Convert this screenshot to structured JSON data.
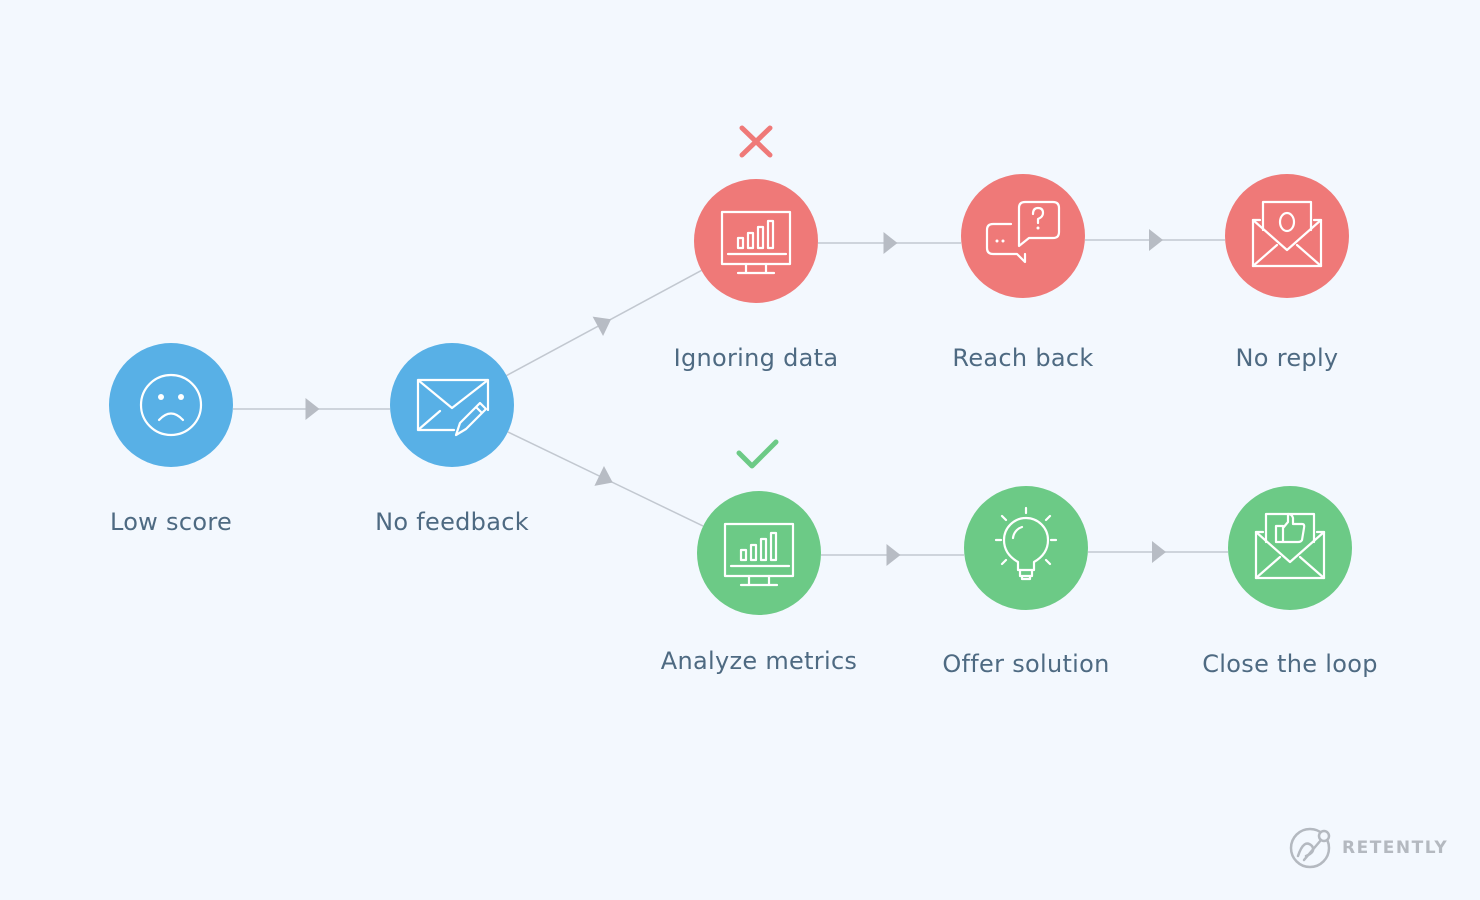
{
  "colors": {
    "background": "#f3f8fe",
    "blue": "#58b0e6",
    "red": "#ef7978",
    "green": "#6cca86",
    "connector": "#c2c8d0",
    "arrow": "#b7bcc4",
    "label": "#4e6a82",
    "fail_mark": "#ef7978",
    "success_mark": "#6cca86",
    "logo": "#b4b9c0"
  },
  "nodes": [
    {
      "id": "low-score",
      "label": "Low score",
      "icon": "sad-face-icon",
      "color": "blue"
    },
    {
      "id": "no-feedback",
      "label": "No feedback",
      "icon": "envelope-pencil-icon",
      "color": "blue"
    },
    {
      "id": "ignoring-data",
      "label": "Ignoring data",
      "icon": "monitor-chart-icon",
      "color": "red"
    },
    {
      "id": "reach-back",
      "label": "Reach back",
      "icon": "chat-question-icon",
      "color": "red"
    },
    {
      "id": "no-reply",
      "label": "No reply",
      "icon": "open-envelope-zero-icon",
      "color": "red"
    },
    {
      "id": "analyze-metrics",
      "label": "Analyze metrics",
      "icon": "monitor-chart-icon",
      "color": "green"
    },
    {
      "id": "offer-solution",
      "label": "Offer solution",
      "icon": "lightbulb-icon",
      "color": "green"
    },
    {
      "id": "close-the-loop",
      "label": "Close the loop",
      "icon": "open-envelope-thumbs-up-icon",
      "color": "green"
    }
  ],
  "edges": [
    {
      "from": "low-score",
      "to": "no-feedback"
    },
    {
      "from": "no-feedback",
      "to": "ignoring-data"
    },
    {
      "from": "no-feedback",
      "to": "analyze-metrics"
    },
    {
      "from": "ignoring-data",
      "to": "reach-back"
    },
    {
      "from": "reach-back",
      "to": "no-reply"
    },
    {
      "from": "analyze-metrics",
      "to": "offer-solution"
    },
    {
      "from": "offer-solution",
      "to": "close-the-loop"
    }
  ],
  "markers": [
    {
      "node": "ignoring-data",
      "type": "cross-icon",
      "meaning": "wrong path"
    },
    {
      "node": "analyze-metrics",
      "type": "check-icon",
      "meaning": "right path"
    }
  ],
  "logo": {
    "text": "RETENTLY"
  }
}
